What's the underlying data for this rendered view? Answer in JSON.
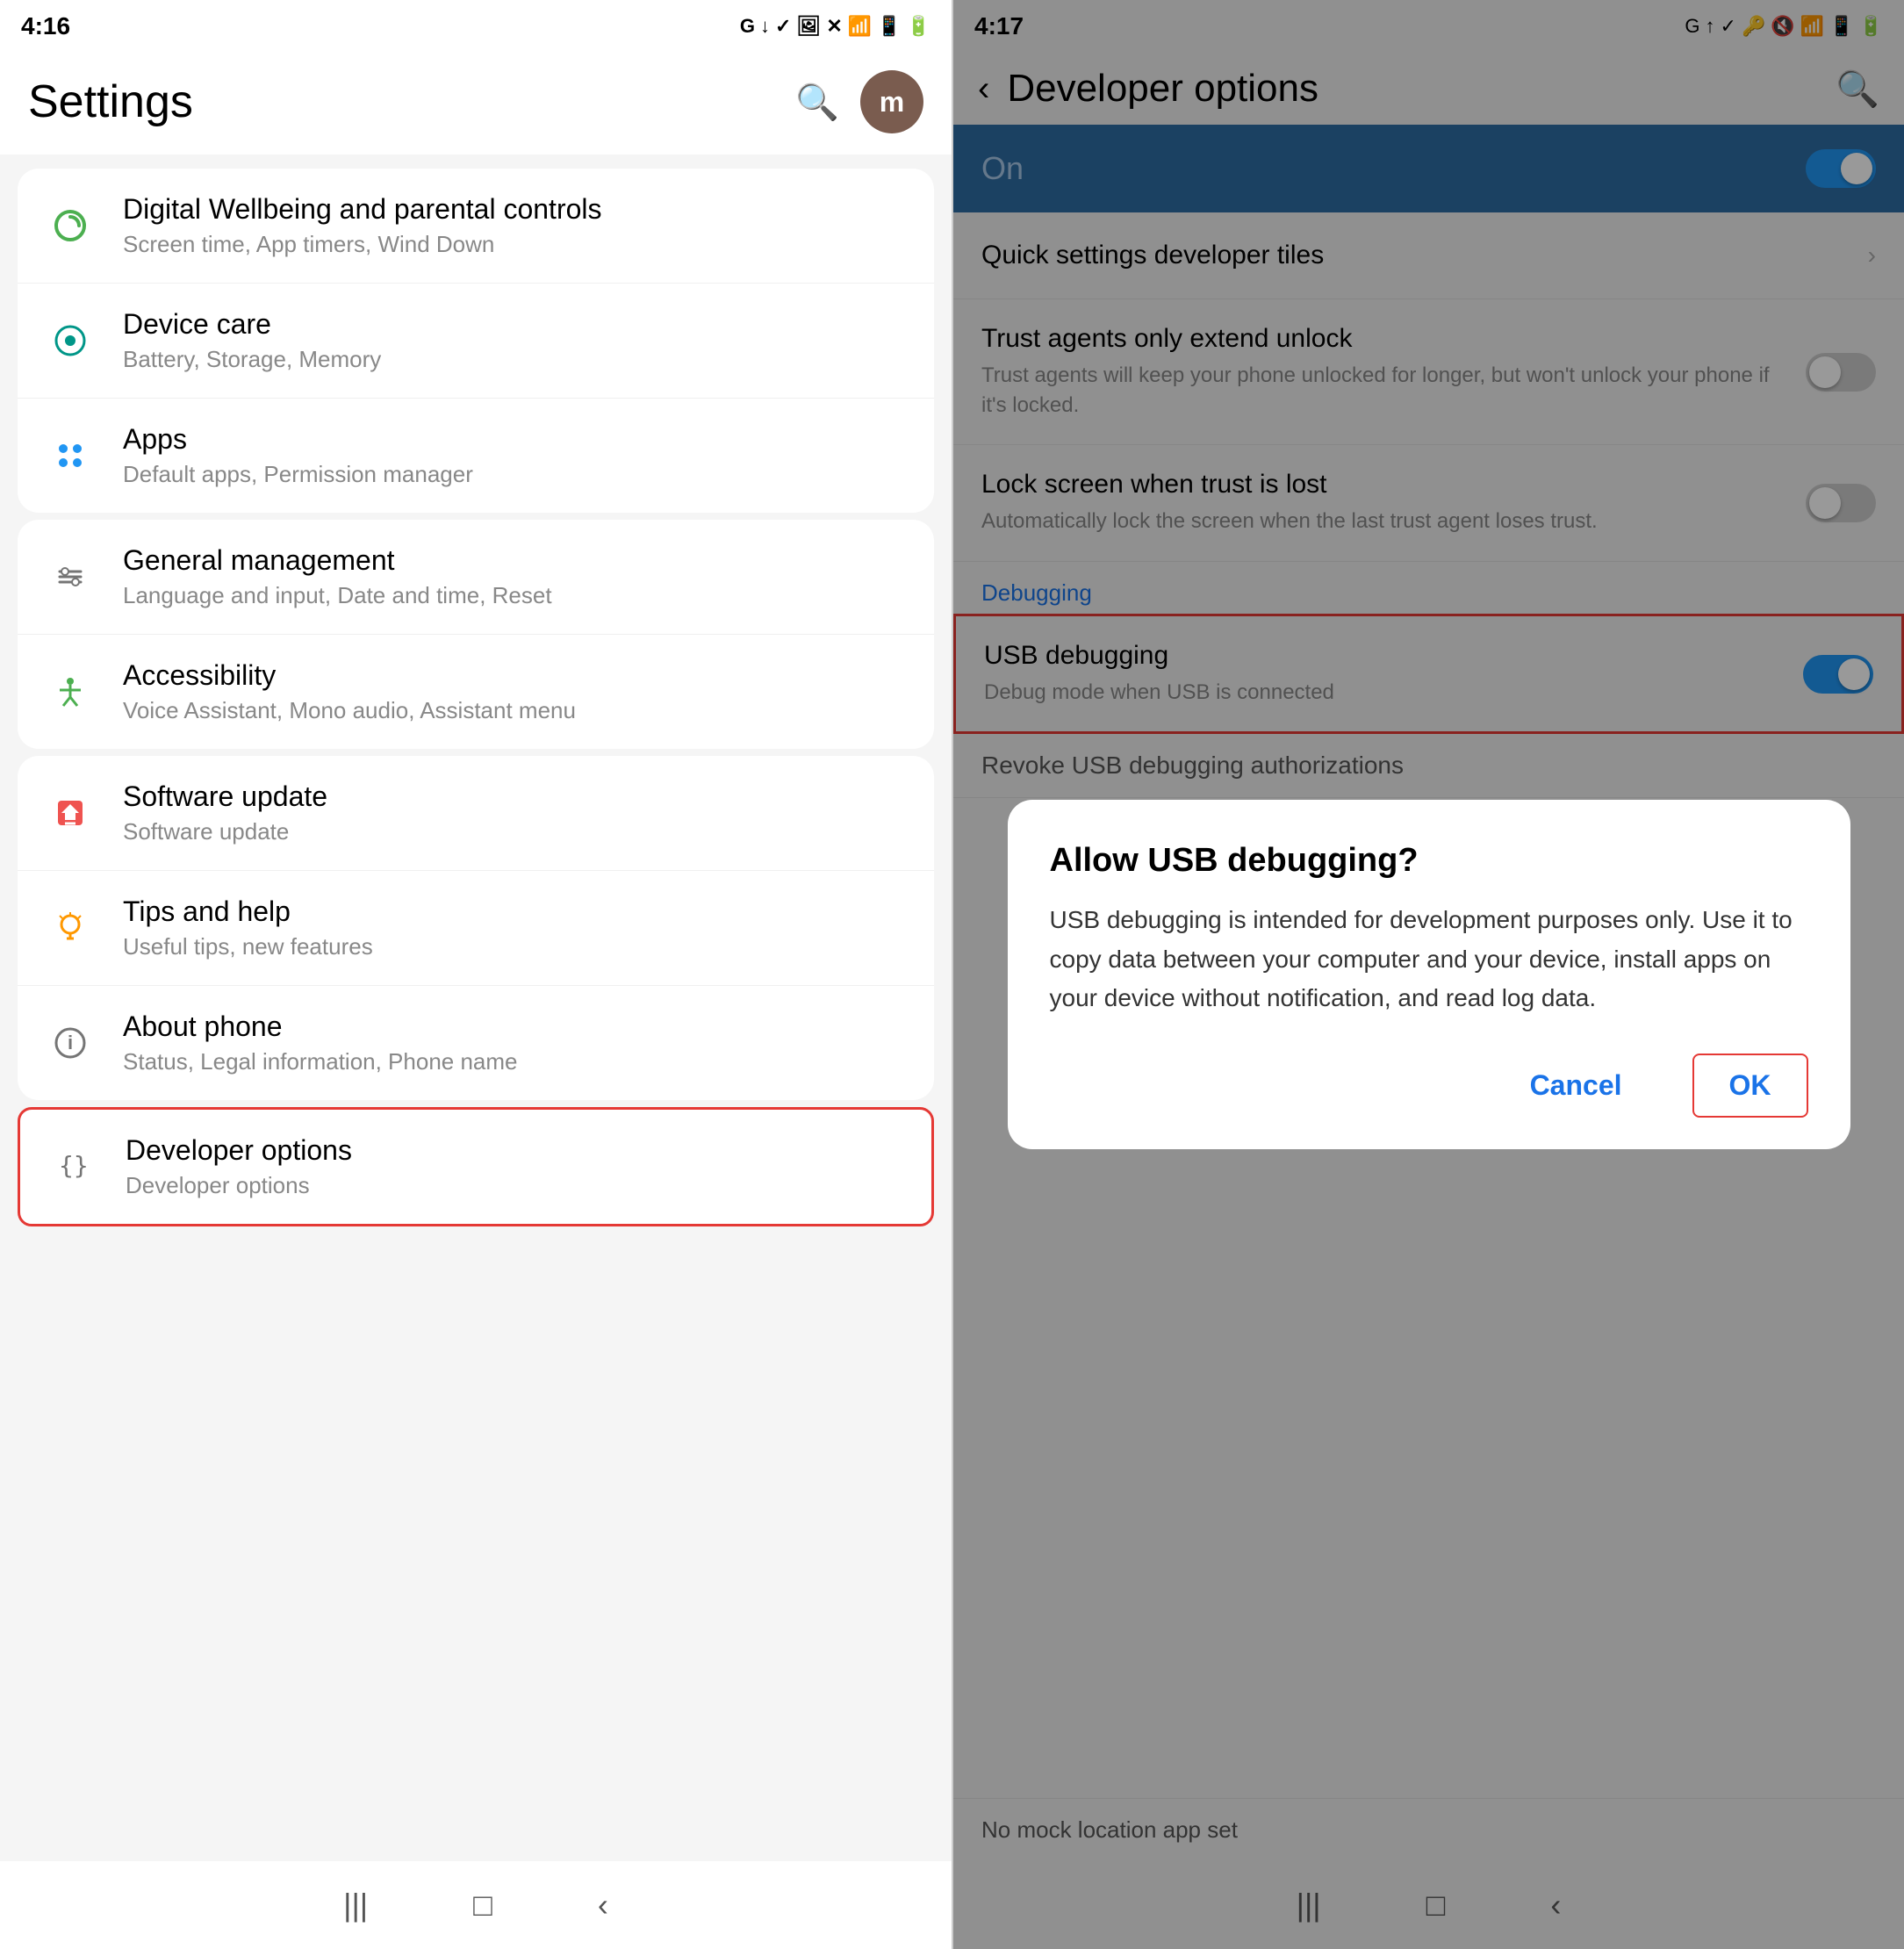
{
  "left": {
    "status": {
      "time": "4:16",
      "icons": [
        "G",
        "↓",
        "✓",
        "🖼",
        "✕"
      ]
    },
    "title": "Settings",
    "avatar_letter": "m",
    "items": [
      {
        "id": "digital-wellbeing",
        "icon": "🌀",
        "icon_color": "icon-green",
        "title": "controls",
        "subtitle": "Screen time, App timers, Wind Down"
      },
      {
        "id": "device-care",
        "icon": "⊙",
        "icon_color": "icon-teal",
        "title": "Device care",
        "subtitle": "Battery, Storage, Memory"
      },
      {
        "id": "apps",
        "icon": "⠿",
        "icon_color": "icon-blue",
        "title": "Apps",
        "subtitle": "Default apps, Permission manager"
      },
      {
        "id": "general-management",
        "icon": "≡",
        "icon_color": "icon-gray",
        "title": "General management",
        "subtitle": "Language and input, Date and time, Reset"
      },
      {
        "id": "accessibility",
        "icon": "♿",
        "icon_color": "icon-green",
        "title": "Accessibility",
        "subtitle": "Voice Assistant, Mono audio, Assistant menu"
      },
      {
        "id": "software-update",
        "icon": "📥",
        "icon_color": "icon-red",
        "title": "Software update",
        "subtitle": "Software update"
      },
      {
        "id": "tips-help",
        "icon": "💡",
        "icon_color": "icon-orange",
        "title": "Tips and help",
        "subtitle": "Useful tips, new features"
      },
      {
        "id": "about-phone",
        "icon": "ℹ",
        "icon_color": "icon-gray",
        "title": "About phone",
        "subtitle": "Status, Legal information, Phone name"
      }
    ],
    "developer_item": {
      "id": "developer-options",
      "icon": "{}",
      "title": "Developer options",
      "subtitle": "Developer options"
    },
    "nav": {
      "menu": "|||",
      "home": "□",
      "back": "‹"
    }
  },
  "right": {
    "status": {
      "time": "4:17",
      "icons": [
        "G",
        "↑",
        "✓",
        "🖼",
        "✕"
      ]
    },
    "title": "Developer options",
    "on_label": "On",
    "toggle_on": true,
    "sections": [
      {
        "id": "quick-settings",
        "label": "Quick settings developer tiles",
        "type": "link"
      },
      {
        "id": "trust-agents",
        "title": "Trust agents only extend unlock",
        "subtitle": "Trust agents will keep your phone unlocked for longer, but won't unlock your phone if it's locked.",
        "type": "toggle",
        "enabled": false
      },
      {
        "id": "lock-screen",
        "title": "Lock screen when trust is lost",
        "subtitle": "Automatically lock the screen when the last trust agent loses trust.",
        "type": "toggle",
        "enabled": false
      }
    ],
    "debugging_label": "Debugging",
    "usb_debugging": {
      "title": "USB debugging",
      "subtitle": "Debug mode when USB is connected",
      "enabled": true
    },
    "revoke_usb": "Revoke USB debugging authorizations",
    "dialog": {
      "title": "Allow USB debugging?",
      "body": "USB debugging is intended for development purposes only. Use it to copy data between your computer and your device, install apps on your device without notification, and read log data.",
      "cancel_label": "Cancel",
      "ok_label": "OK"
    },
    "mock_location": "No mock location app set",
    "nav": {
      "menu": "|||",
      "home": "□",
      "back": "‹"
    }
  }
}
